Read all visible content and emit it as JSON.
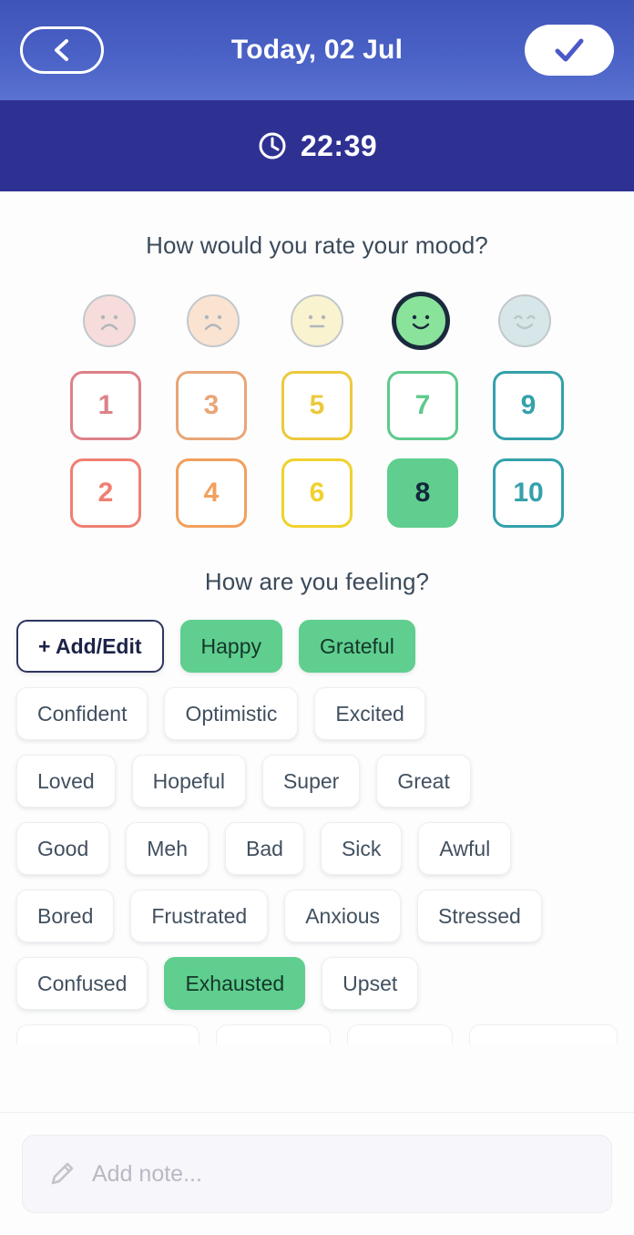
{
  "header": {
    "title": "Today, 02 Jul",
    "back_icon": "chevron-left-icon",
    "confirm_icon": "check-icon"
  },
  "timebar": {
    "clock_icon": "clock-icon",
    "time": "22:39"
  },
  "mood": {
    "question": "How would you rate your mood?",
    "faces": [
      {
        "expression": "very-sad",
        "fill": "#f7dcdc",
        "stroke": "#b0b6bb",
        "selected": false
      },
      {
        "expression": "sad",
        "fill": "#fbe3d2",
        "stroke": "#b0b6bb",
        "selected": false
      },
      {
        "expression": "neutral",
        "fill": "#faf3cf",
        "stroke": "#b0b6bb",
        "selected": false
      },
      {
        "expression": "happy",
        "fill": "#8ae39b",
        "stroke": "#1b2a3d",
        "selected": true
      },
      {
        "expression": "very-happy",
        "fill": "#d7e6e8",
        "stroke": "#b9c7c9",
        "selected": false
      }
    ],
    "selected_value": 8,
    "scale": [
      {
        "value": "1",
        "color": "#dd8189",
        "selected": false
      },
      {
        "value": "2",
        "color": "#ef7f72",
        "selected": false
      },
      {
        "value": "3",
        "color": "#e8a678",
        "selected": false
      },
      {
        "value": "4",
        "color": "#f2a05d",
        "selected": false
      },
      {
        "value": "5",
        "color": "#ecc93c",
        "selected": false
      },
      {
        "value": "6",
        "color": "#f0d22e",
        "selected": false
      },
      {
        "value": "7",
        "color": "#5ec98c",
        "selected": false
      },
      {
        "value": "8",
        "color": "#5fce8e",
        "selected": true
      },
      {
        "value": "9",
        "color": "#34a1ab",
        "selected": false
      },
      {
        "value": "10",
        "color": "#34a1ab",
        "selected": false
      }
    ]
  },
  "feelings": {
    "question": "How are you feeling?",
    "add_edit_label": "+ Add/Edit",
    "rows": [
      [
        {
          "label": "Happy",
          "selected": true
        },
        {
          "label": "Grateful",
          "selected": true
        }
      ],
      [
        {
          "label": "Confident",
          "selected": false
        },
        {
          "label": "Optimistic",
          "selected": false
        },
        {
          "label": "Excited",
          "selected": false
        }
      ],
      [
        {
          "label": "Loved",
          "selected": false
        },
        {
          "label": "Hopeful",
          "selected": false
        },
        {
          "label": "Super",
          "selected": false
        },
        {
          "label": "Great",
          "selected": false
        }
      ],
      [
        {
          "label": "Good",
          "selected": false
        },
        {
          "label": "Meh",
          "selected": false
        },
        {
          "label": "Bad",
          "selected": false
        },
        {
          "label": "Sick",
          "selected": false
        },
        {
          "label": "Awful",
          "selected": false
        }
      ],
      [
        {
          "label": "Bored",
          "selected": false
        },
        {
          "label": "Frustrated",
          "selected": false
        },
        {
          "label": "Anxious",
          "selected": false
        },
        {
          "label": "Stressed",
          "selected": false
        }
      ],
      [
        {
          "label": "Confused",
          "selected": false
        },
        {
          "label": "Exhausted",
          "selected": true
        },
        {
          "label": "Upset",
          "selected": false
        }
      ]
    ],
    "selected_accent": "#5fce8e"
  },
  "note": {
    "pencil_icon": "pencil-icon",
    "placeholder": "Add note..."
  }
}
